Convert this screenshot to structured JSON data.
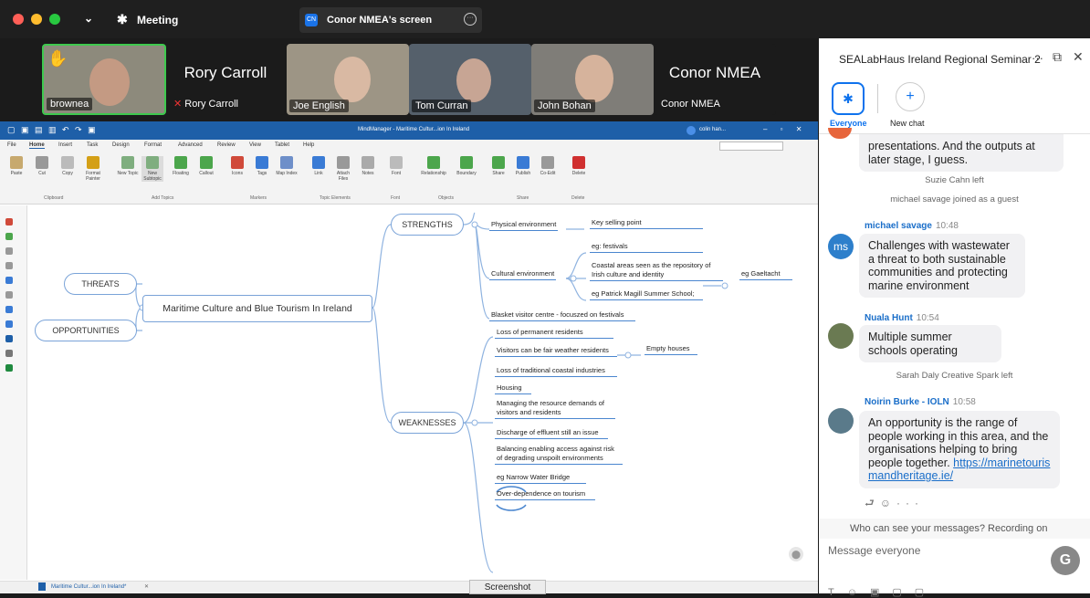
{
  "topbar": {
    "meeting_label": "Meeting",
    "share_label": "Conor NMEA's screen",
    "share_badge": "CN"
  },
  "participants": [
    {
      "name": "brownea",
      "display": ""
    },
    {
      "name": "Rory Carroll",
      "display": "Rory Carroll"
    },
    {
      "name": "Joe English",
      "display": ""
    },
    {
      "name": "Tom Curran",
      "display": ""
    },
    {
      "name": "John Bohan",
      "display": ""
    },
    {
      "name": "Conor NMEA",
      "display": "Conor NMEA"
    }
  ],
  "mindmanager": {
    "title": "MindManager - Maritime Cultur...ion In Ireland",
    "user": "colin han...",
    "menu": [
      "File",
      "Home",
      "Insert",
      "Task",
      "Design",
      "Format",
      "Advanced",
      "Review",
      "View",
      "Tablet",
      "Help"
    ],
    "ribbon": {
      "buttons": [
        "Paste",
        "Cut",
        "Copy",
        "Format Painter",
        "New Topic",
        "New Subtopic",
        "Floating",
        "Callout",
        "Icons",
        "Tags",
        "Map Index",
        "Link",
        "Attach Files",
        "Notes",
        "Font",
        "Relationship",
        "Boundary",
        "Share",
        "Publish",
        "Co-Edit",
        "Delete"
      ],
      "groups": [
        "Clipboard",
        "Add Topics",
        "Markers",
        "Topic Elements",
        "Font",
        "Objects",
        "Share",
        "Delete"
      ]
    },
    "central": "Maritime Culture and Blue Tourism In Ireland",
    "main_topics": {
      "strengths": "STRENGTHS",
      "threats": "THREATS",
      "opportunities": "OPPORTUNITIES",
      "weaknesses": "WEAKNESSES"
    },
    "strengths": {
      "physical": "Physical environment",
      "key_selling": "Key selling point",
      "cultural": "Cultural environment",
      "festivals": "eg: festivals",
      "coastal": "Coastal areas seen as the repository of Irish culture and identity",
      "gaeltacht": "eg Gaeltacht",
      "magill": "eg Patrick Magill Summer School;",
      "blasket": "Blasket visitor centre - focuszed on festivals"
    },
    "weaknesses": [
      "Loss of permanent residents",
      "Visitors can be fair weather residents",
      "Loss of traditional coastal industries",
      "Housing",
      "Managing the resource demands of visitors and residents",
      "Discharge of effluent still an issue",
      "Balancing enabling access against risk of degrading unspoilt environments",
      "eg Narrow Water Bridge",
      "Over-dependence on tourism"
    ],
    "empty_houses": "Empty houses",
    "doc_tab": "Maritime Cultur...ion In Ireland*",
    "screenshot_label": "Screenshot"
  },
  "chat": {
    "title": "SEALabHaus Ireland Regional Seminar 2",
    "tab_everyone": "Everyone",
    "tab_new": "New chat",
    "msg0": "presentations. And the outputs at later stage, I guess.",
    "sys1": "Suzie Cahn left",
    "sys2": "michael savage joined as a guest",
    "m1_name": "michael savage",
    "m1_time": "10:48",
    "m1_avatar": "ms",
    "m1_text": "Challenges with wastewater a threat to both sustainable communities and protecting marine environment",
    "m2_name": "Nuala Hunt",
    "m2_time": "10:54",
    "m2_text": "Multiple summer schools operating",
    "sys3": "Sarah Daly Creative Spark left",
    "m3_name": "Noirin Burke - IOLN",
    "m3_time": "10:58",
    "m3_text": "An opportunity is the range of people working in this area, and the organisations helping to bring people together. ",
    "m3_link": "https://marinetourismandheritage.ie/",
    "notice": "Who can see your messages? Recording on",
    "input_placeholder": "Message everyone",
    "accent": "#0e72ed"
  }
}
